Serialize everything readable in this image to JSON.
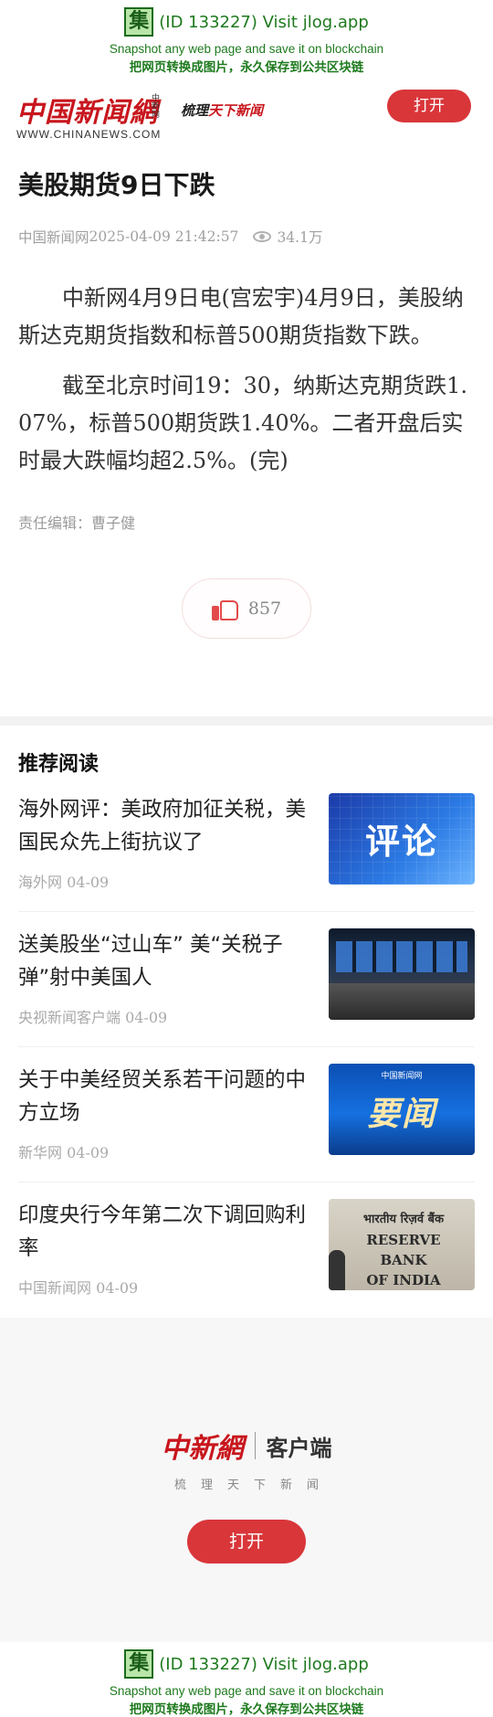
{
  "jlog": {
    "logo_char": "集",
    "title": "(ID 133227) Visit jlog.app",
    "subtitle_en": "Snapshot any web page and save it on blockchain",
    "subtitle_cn": "把网页转换成图片，永久保存到公共区块链"
  },
  "header": {
    "brand_cn": "中国新闻網",
    "brand_tag": "中新网",
    "brand_en": "WWW.CHINANEWS.COM",
    "slogan_first": "梳理",
    "slogan_rest": "天下新闻",
    "open_label": "打开"
  },
  "article": {
    "title": "美股期货9日下跌",
    "source": "中国新闻网",
    "datetime": "2025-04-09 21:42:57",
    "views": "34.1万",
    "paragraphs": [
      "中新网4月9日电(宫宏宇)4月9日，美股纳斯达克期货指数和标普500期货指数下跌。",
      "截至北京时间19：30，纳斯达克期货跌1. 07%，标普500期货跌1.40%。二者开盘后实时最大跌幅均超2.5%。(完)"
    ],
    "editor": "责任编辑：曹子健",
    "likes": "857"
  },
  "recommend": {
    "heading": "推荐阅读",
    "items": [
      {
        "title": "海外网评：美政府加征关税，美国民众先上街抗议了",
        "source": "海外网",
        "date": "04-09",
        "thumb_text": "评论"
      },
      {
        "title": "送美股坐“过山车” 美“关税子弹”射中美国人",
        "source": "央视新闻客户端",
        "date": "04-09",
        "thumb_text": ""
      },
      {
        "title": "关于中美经贸关系若干问题的中方立场",
        "source": "新华网",
        "date": "04-09",
        "thumb_text": "要闻",
        "thumb_mini": "中国新闻网"
      },
      {
        "title": "印度央行今年第二次下调回购利率",
        "source": "中国新闻网",
        "date": "04-09",
        "thumb_lines": [
          "भारतीय रिज़र्व बैंक",
          "RESERVE BANK",
          "OF INDIA"
        ]
      }
    ]
  },
  "promo": {
    "brand": "中新網",
    "client": "客户端",
    "tagline": "梳理天下新闻",
    "open_label": "打开"
  }
}
